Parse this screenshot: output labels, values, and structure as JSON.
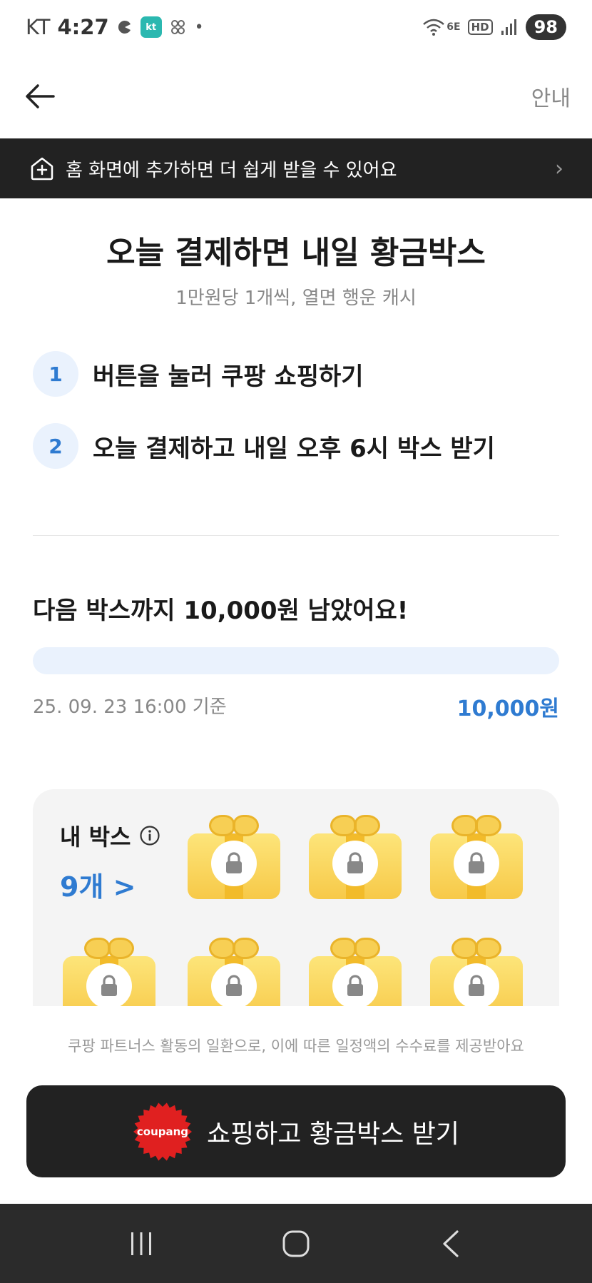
{
  "status_bar": {
    "carrier": "KT",
    "time": "4:27",
    "kt_badge": "kt",
    "network": "6E",
    "hd": "HD",
    "battery": "98"
  },
  "header": {
    "guide_label": "안내"
  },
  "banner": {
    "text": "홈 화면에 추가하면 더 쉽게 받을 수 있어요",
    "arrow": "›"
  },
  "main": {
    "title": "오늘 결제하면 내일 황금박스",
    "subtitle": "1만원당 1개씩, 열면 행운 캐시",
    "steps": [
      {
        "num": "1",
        "text": "버튼을 눌러 쿠팡 쇼핑하기"
      },
      {
        "num": "2",
        "text": "오늘 결제하고 내일 오후 6시 박스 받기"
      }
    ]
  },
  "progress": {
    "heading": "다음 박스까지 10,000원 남았어요!",
    "fill_percent": 0,
    "reference_time": "25. 09. 23 16:00 기준",
    "amount": "10,000원"
  },
  "my_box": {
    "title": "내 박스",
    "count": "9개 >",
    "visible_boxes": 7
  },
  "disclaimer": "쿠팡 파트너스 활동의 일환으로, 이에 따른 일정액의 수수료를 제공받아요",
  "cta": {
    "badge_text": "coupang",
    "label": "쇼핑하고 황금박스 받기"
  },
  "colors": {
    "accent": "#2f7bd1",
    "dark": "#222222",
    "badge_red": "#e02020",
    "gift_yellow": "#f7c948"
  },
  "icons": {
    "back": "arrow-left-icon",
    "home_add": "home-plus-icon",
    "info": "info-icon",
    "lock": "lock-icon",
    "nav_recent": "recent-apps-icon",
    "nav_home": "home-icon",
    "nav_back": "chevron-left-icon"
  }
}
